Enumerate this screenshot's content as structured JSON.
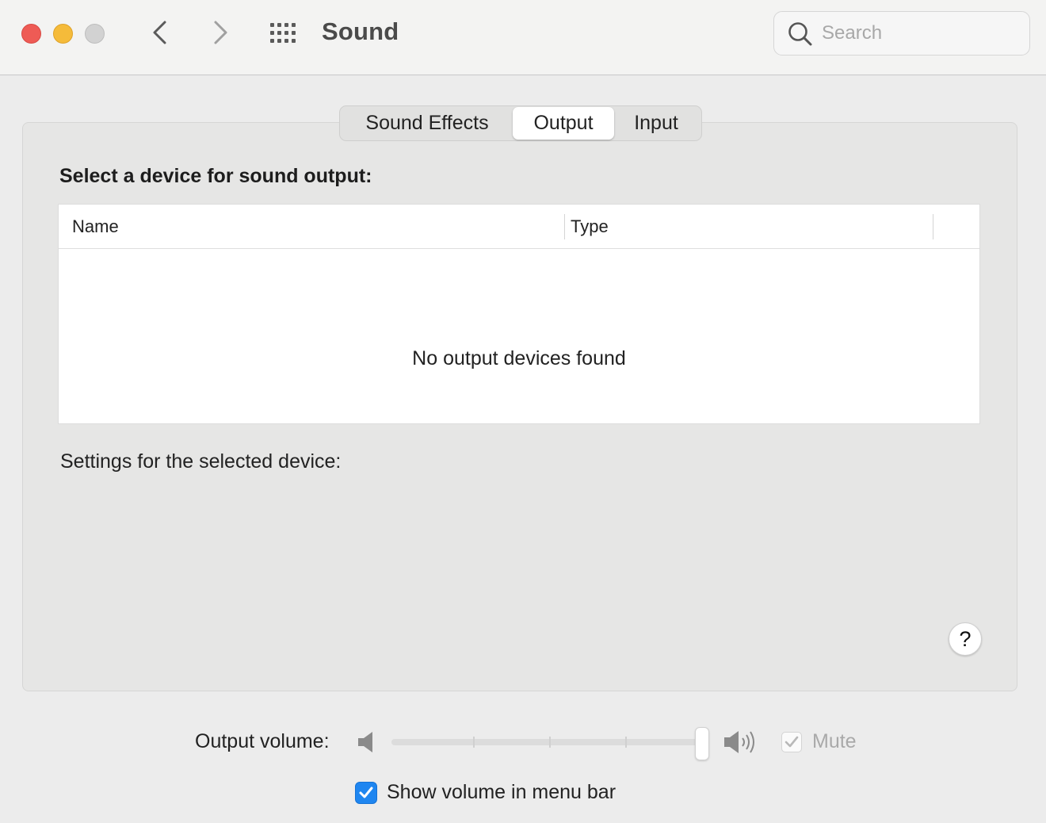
{
  "window": {
    "title": "Sound",
    "search_placeholder": "Search"
  },
  "icons": {
    "back": "chevron-left-icon",
    "forward": "chevron-right-icon",
    "show_all": "grid-icon",
    "search": "magnifier-icon"
  },
  "tabs": [
    {
      "label": "Sound Effects",
      "selected": false
    },
    {
      "label": "Output",
      "selected": true
    },
    {
      "label": "Input",
      "selected": false
    }
  ],
  "output": {
    "section_title": "Select a device for sound output:",
    "columns": [
      "Name",
      "Type"
    ],
    "empty_message": "No output devices found",
    "settings_label": "Settings for the selected device:"
  },
  "help": {
    "label": "?"
  },
  "volume": {
    "label": "Output volume:",
    "level": 1.0,
    "mute_label": "Mute",
    "mute_checked": true,
    "mute_enabled": false
  },
  "menubar": {
    "label": "Show volume in menu bar",
    "checked": true
  },
  "colors": {
    "close": "#ee5b55",
    "minimize": "#f5bb3a",
    "zoom": "#d2d2d2",
    "accent": "#1f86f0"
  }
}
